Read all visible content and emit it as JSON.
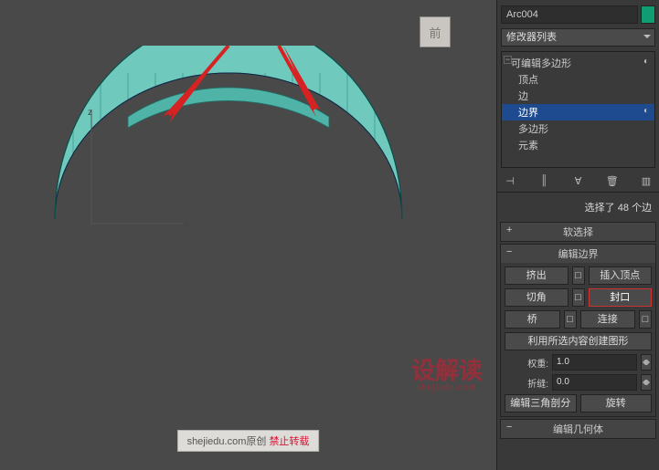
{
  "viewport": {
    "cube_label": "前",
    "credit_site": "shejiedu.com原创 ",
    "credit_warn": "禁止转载",
    "watermark": "设解读",
    "watermark_sub": "shejiedu.com"
  },
  "object": {
    "name": "Arc004",
    "color": "#0e9e72"
  },
  "modifier_dropdown": "修改器列表",
  "stack": {
    "parent": "可编辑多边形",
    "items": [
      "顶点",
      "边",
      "边界",
      "多边形",
      "元素"
    ],
    "selected_index": 2
  },
  "status": "选择了 48 个边",
  "rollouts": {
    "soft": "软选择",
    "edit_border": "编辑边界",
    "extrude": "挤出",
    "insert_vertex": "插入顶点",
    "chamfer": "切角",
    "cap": "封口",
    "bridge": "桥",
    "connect": "连接",
    "create_shape": "利用所选内容创建图形",
    "weight_label": "权重:",
    "weight_val": "1.0",
    "crease_label": "折缝:",
    "crease_val": "0.0",
    "edit_tri": "编辑三角剖分",
    "rotate": "旋转",
    "edit_geom": "编辑几何体"
  }
}
